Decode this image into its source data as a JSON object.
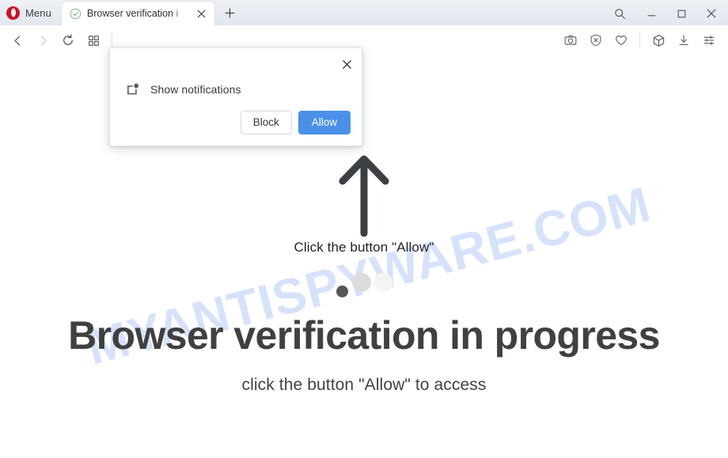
{
  "browser": {
    "name": "Opera",
    "menu_label": "Menu",
    "logo_color": "#cf1126",
    "tab": {
      "title": "Browser verification i",
      "favicon": "check-circle-icon",
      "close": "close-icon"
    },
    "new_tab": "plus-icon",
    "window_controls": [
      {
        "name": "search",
        "icon": "search-icon"
      },
      {
        "name": "minimize",
        "icon": "minimize-icon"
      },
      {
        "name": "maximize",
        "icon": "maximize-icon"
      },
      {
        "name": "close",
        "icon": "close-icon"
      }
    ],
    "nav_left": [
      {
        "name": "back",
        "icon": "back-arrow-icon",
        "enabled": true
      },
      {
        "name": "forward",
        "icon": "forward-arrow-icon",
        "enabled": false
      },
      {
        "name": "reload",
        "icon": "reload-icon",
        "enabled": true
      },
      {
        "name": "speed-dial",
        "icon": "grid-squares-icon",
        "enabled": true
      }
    ],
    "address_value": "",
    "address_placeholder": "",
    "nav_right": [
      {
        "name": "snapshot",
        "icon": "camera-icon"
      },
      {
        "name": "ad-blocker",
        "icon": "shield-x-icon"
      },
      {
        "name": "favorites",
        "icon": "heart-icon"
      },
      {
        "name": "extensions",
        "icon": "cube-icon"
      },
      {
        "name": "downloads",
        "icon": "download-icon"
      },
      {
        "name": "easy-setup",
        "icon": "sliders-icon"
      }
    ]
  },
  "notification_dialog": {
    "icon": "notification-badge-icon",
    "message": "Show notifications",
    "block_label": "Block",
    "allow_label": "Allow",
    "close_icon": "close-icon",
    "allow_color": "#4a90e8"
  },
  "page": {
    "watermark": "MYANTISPYWARE.COM",
    "watermark_color": "#d6e2fb",
    "arrow_icon": "up-arrow-icon",
    "arrow_caption": "Click the button \"Allow\"",
    "loading_dots": 3,
    "headline": "Browser verification in progress",
    "subline": "click the button \"Allow\" to access"
  }
}
